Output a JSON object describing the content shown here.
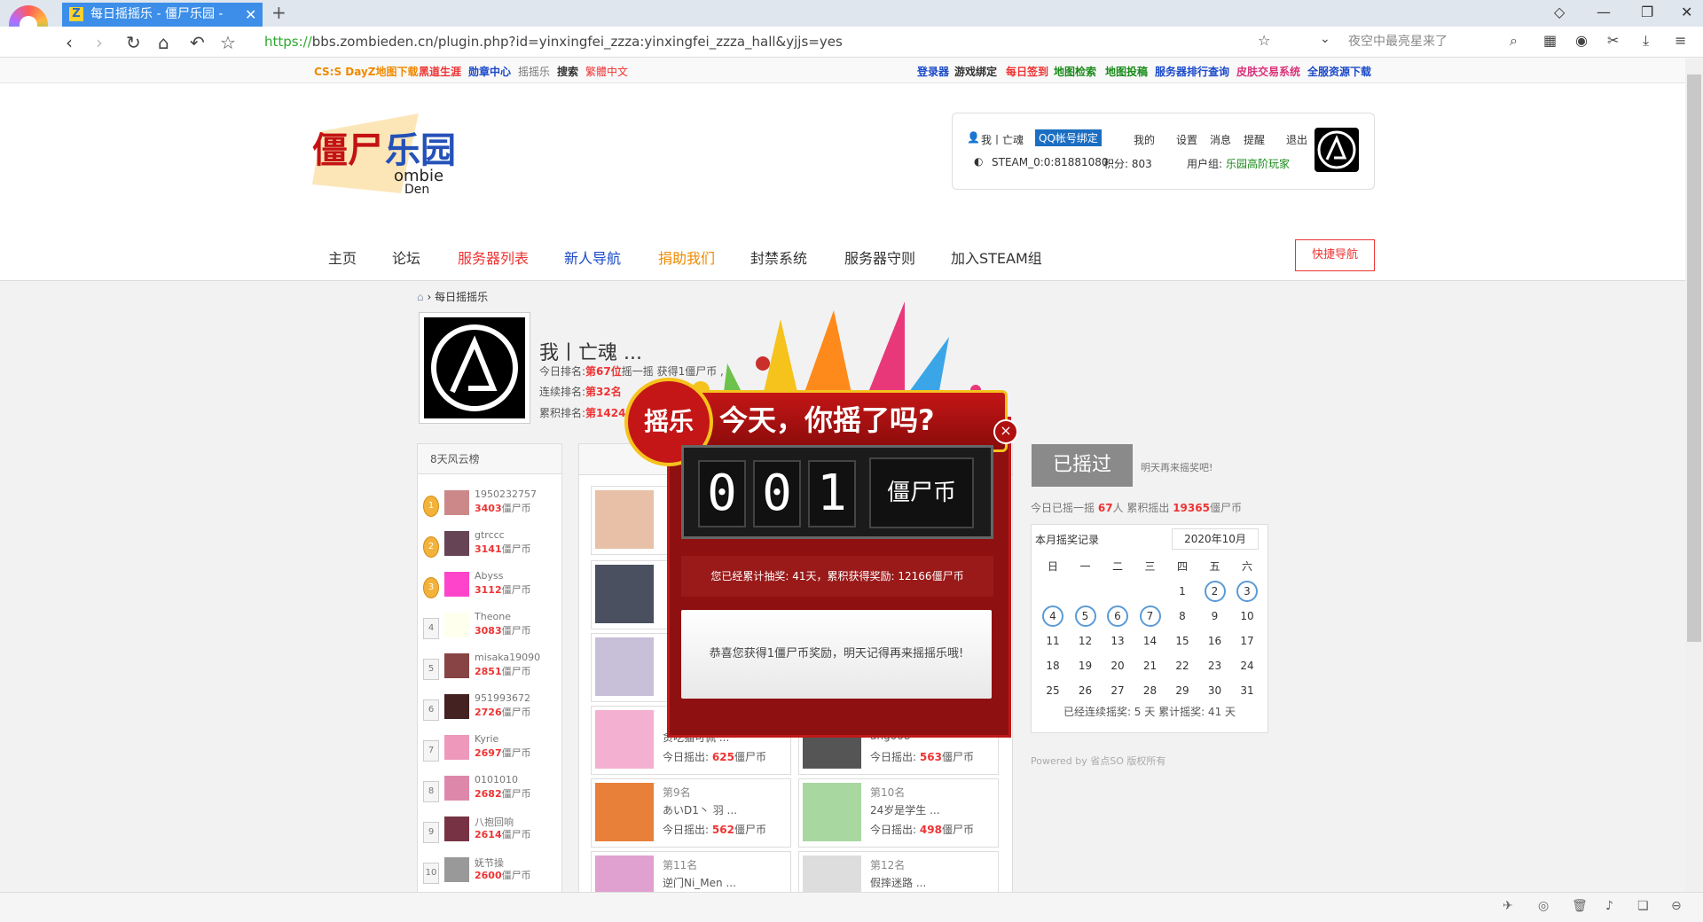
{
  "browser": {
    "tab_title": "每日摇摇乐 - 僵尸乐园 -",
    "url_prefix": "https://",
    "url_rest": "bbs.zombieden.cn/plugin.php?id=yinxingfei_zzza:yinxingfei_zzza_hall&yjjs=yes",
    "search_placeholder": "夜空中最亮星来了",
    "new_tab": "+",
    "tab_close": "✕"
  },
  "bookmarks_left": [
    "CS:S DayZ地图下载",
    "黑道生涯",
    "勋章中心",
    "摇摇乐",
    "搜索",
    "繁體中文"
  ],
  "bookmarks_right": [
    "登录器",
    "游戏绑定",
    "每日签到",
    "地图检索",
    "地图投稿",
    "服务器排行查询",
    "皮肤交易系统",
    "全服资源下载"
  ],
  "user": {
    "name": "我丨亡魂",
    "qq_bind": "QQ帐号绑定",
    "menu": [
      "我的",
      "设置",
      "消息",
      "提醒",
      "退出"
    ],
    "steam_id": "STEAM_0:0:81881080",
    "points": "积分: 803",
    "group_label": "用户组:",
    "group": "乐园高阶玩家"
  },
  "nav": [
    "主页",
    "论坛",
    "服务器列表",
    "新人导航",
    "捐助我们",
    "封禁系统",
    "服务器守则",
    "加入STEAM组"
  ],
  "quick_nav": "快捷导航",
  "breadcrumb": "每日摇摇乐",
  "profile": {
    "name": "我丨亡魂 ...",
    "today_line_prefix": "今日排名:",
    "today_rank": "第67位",
    "today_text": "摇一摇 获得1僵尸币 ,",
    "streak_prefix": "连续排名:",
    "streak_rank": "第32名",
    "total_prefix": "累积排名:",
    "total_rank": "第1424"
  },
  "leaderboard": {
    "title": "8天风云榜",
    "items": [
      {
        "rank": "1",
        "name": "1950232757",
        "pts": "3403",
        "unit": "僵尸币"
      },
      {
        "rank": "2",
        "name": "gtrccc",
        "pts": "3141",
        "unit": "僵尸币"
      },
      {
        "rank": "3",
        "name": "Abyss",
        "pts": "3112",
        "unit": "僵尸币"
      },
      {
        "rank": "4",
        "name": "Theone",
        "pts": "3083",
        "unit": "僵尸币"
      },
      {
        "rank": "5",
        "name": "misaka19090",
        "pts": "2851",
        "unit": "僵尸币"
      },
      {
        "rank": "6",
        "name": "951993672",
        "pts": "2726",
        "unit": "僵尸币"
      },
      {
        "rank": "7",
        "name": "Kyrie",
        "pts": "2697",
        "unit": "僵尸币"
      },
      {
        "rank": "8",
        "name": "0101010",
        "pts": "2682",
        "unit": "僵尸币"
      },
      {
        "rank": "9",
        "name": "八抱回响",
        "pts": "2614",
        "unit": "僵尸币"
      },
      {
        "rank": "10",
        "name": "妩节操",
        "pts": "2600",
        "unit": "僵尸币"
      }
    ]
  },
  "cards": [
    {
      "rank": "",
      "name": "贪吃猫可佩 ...",
      "out_prefix": "今日摇出:",
      "out": "625",
      "unit": "僵尸币"
    },
    {
      "rank": "",
      "name": "ang008",
      "out_prefix": "今日摇出:",
      "out": "563",
      "unit": "僵尸币"
    },
    {
      "rank": "第9名",
      "name": "あいD1丶 羽 ...",
      "out_prefix": "今日摇出:",
      "out": "562",
      "unit": "僵尸币"
    },
    {
      "rank": "第10名",
      "name": "24岁是学生 ...",
      "out_prefix": "今日摇出:",
      "out": "498",
      "unit": "僵尸币"
    },
    {
      "rank": "第11名",
      "name": "逆门Ni_Men ...",
      "out_prefix": "",
      "out": "",
      "unit": ""
    },
    {
      "rank": "第12名",
      "name": "假摔迷路 ...",
      "out_prefix": "",
      "out": "",
      "unit": ""
    }
  ],
  "right": {
    "shaken_btn": "已摇过",
    "come_back": "明天再来摇奖吧!",
    "today_prefix": "今日已摇一摇",
    "today_count": "67",
    "today_mid": "人 累积摇出",
    "today_total": "19365",
    "today_unit": "僵尸币"
  },
  "calendar": {
    "title": "本月摇奖记录",
    "month": "2020年10月",
    "weekdays": [
      "日",
      "一",
      "二",
      "三",
      "四",
      "五",
      "六"
    ],
    "days": [
      "",
      "",
      "",
      "",
      "1",
      "2",
      "3",
      "4",
      "5",
      "6",
      "7",
      "8",
      "9",
      "10",
      "11",
      "12",
      "13",
      "14",
      "15",
      "16",
      "17",
      "18",
      "19",
      "20",
      "21",
      "22",
      "23",
      "24",
      "25",
      "26",
      "27",
      "28",
      "29",
      "30",
      "31"
    ],
    "marked": [
      "2",
      "3",
      "4",
      "5",
      "6",
      "7"
    ],
    "footer": "已经连续摇奖: 5 天  累计摇奖: 41 天"
  },
  "powered": "Powered by 省点SO 版权所有",
  "popup": {
    "badge": "摇乐",
    "title": "今天，你摇了吗?",
    "digits": [
      "0",
      "0",
      "1"
    ],
    "coin_label": "僵尸币",
    "stats": "您已经累计抽奖: 41天，累积获得奖励: 12166僵尸币",
    "message": "恭喜您获得1僵尸币奖励，明天记得再来摇摇乐哦!",
    "close": "×"
  }
}
